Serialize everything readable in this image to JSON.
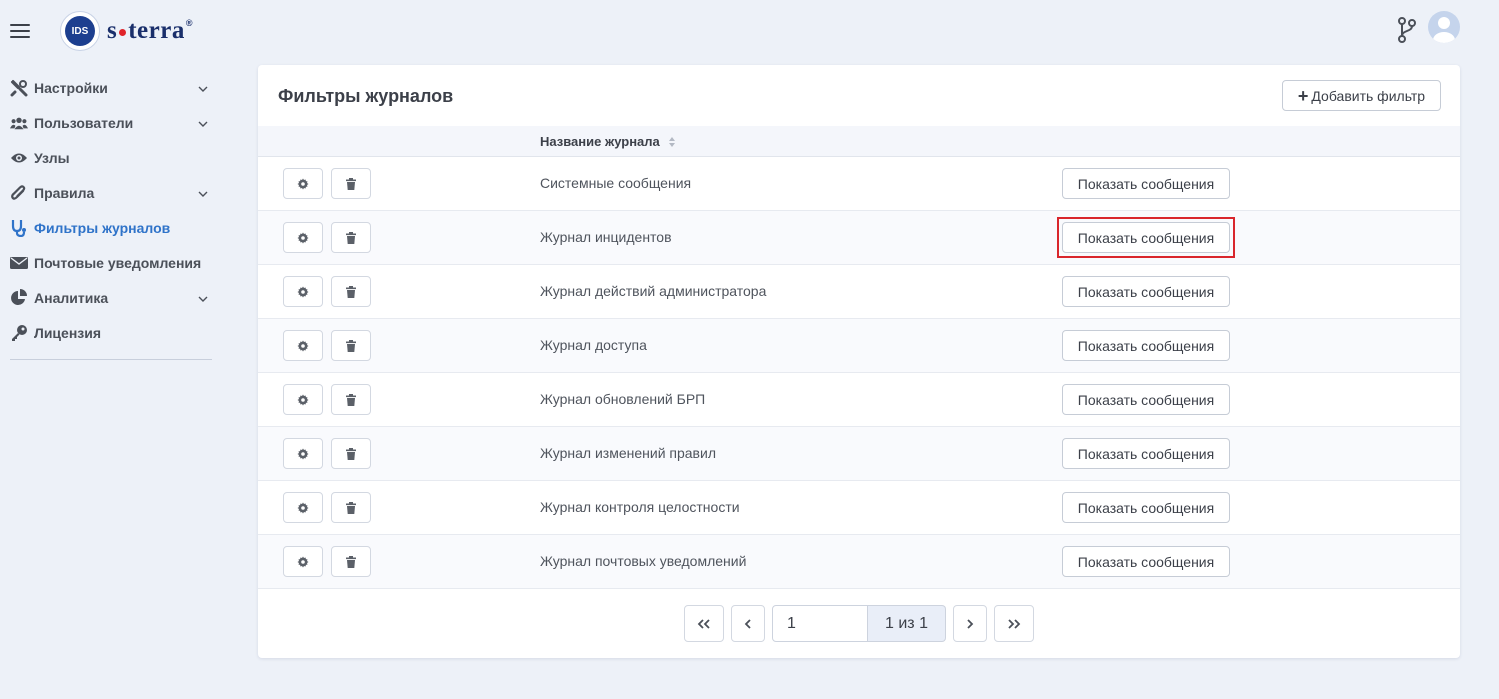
{
  "app": {
    "logo_badge": "IDS",
    "logo_text_left": "s",
    "logo_text_right": "terra",
    "logo_reg": "®"
  },
  "sidebar": {
    "items": [
      {
        "label": "Настройки",
        "icon": "tools-icon",
        "has_chevron": true,
        "active": false
      },
      {
        "label": "Пользователи",
        "icon": "users-icon",
        "has_chevron": true,
        "active": false
      },
      {
        "label": "Узлы",
        "icon": "eye-icon",
        "has_chevron": false,
        "active": false
      },
      {
        "label": "Правила",
        "icon": "paperclip-icon",
        "has_chevron": true,
        "active": false
      },
      {
        "label": "Фильтры журналов",
        "icon": "stethoscope-icon",
        "has_chevron": false,
        "active": true
      },
      {
        "label": "Почтовые уведомления",
        "icon": "envelope-icon",
        "has_chevron": false,
        "active": false
      },
      {
        "label": "Аналитика",
        "icon": "pie-chart-icon",
        "has_chevron": true,
        "active": false
      },
      {
        "label": "Лицензия",
        "icon": "key-icon",
        "has_chevron": false,
        "active": false
      }
    ]
  },
  "main": {
    "title": "Фильтры журналов",
    "add_button_label": "Добавить фильтр",
    "column_header": "Название журнала",
    "show_button_label": "Показать сообщения",
    "rows": [
      {
        "name": "Системные сообщения"
      },
      {
        "name": "Журнал инцидентов"
      },
      {
        "name": "Журнал действий администратора"
      },
      {
        "name": "Журнал доступа"
      },
      {
        "name": "Журнал обновлений БРП"
      },
      {
        "name": "Журнал изменений правил"
      },
      {
        "name": "Журнал контроля целостности"
      },
      {
        "name": "Журнал почтовых уведомлений"
      }
    ],
    "highlighted_row": 1
  },
  "pagination": {
    "page_value": "1",
    "page_info": "1 из 1"
  },
  "colors": {
    "accent": "#2f73c9",
    "highlight": "#d9262c",
    "background": "#edf1f8"
  }
}
